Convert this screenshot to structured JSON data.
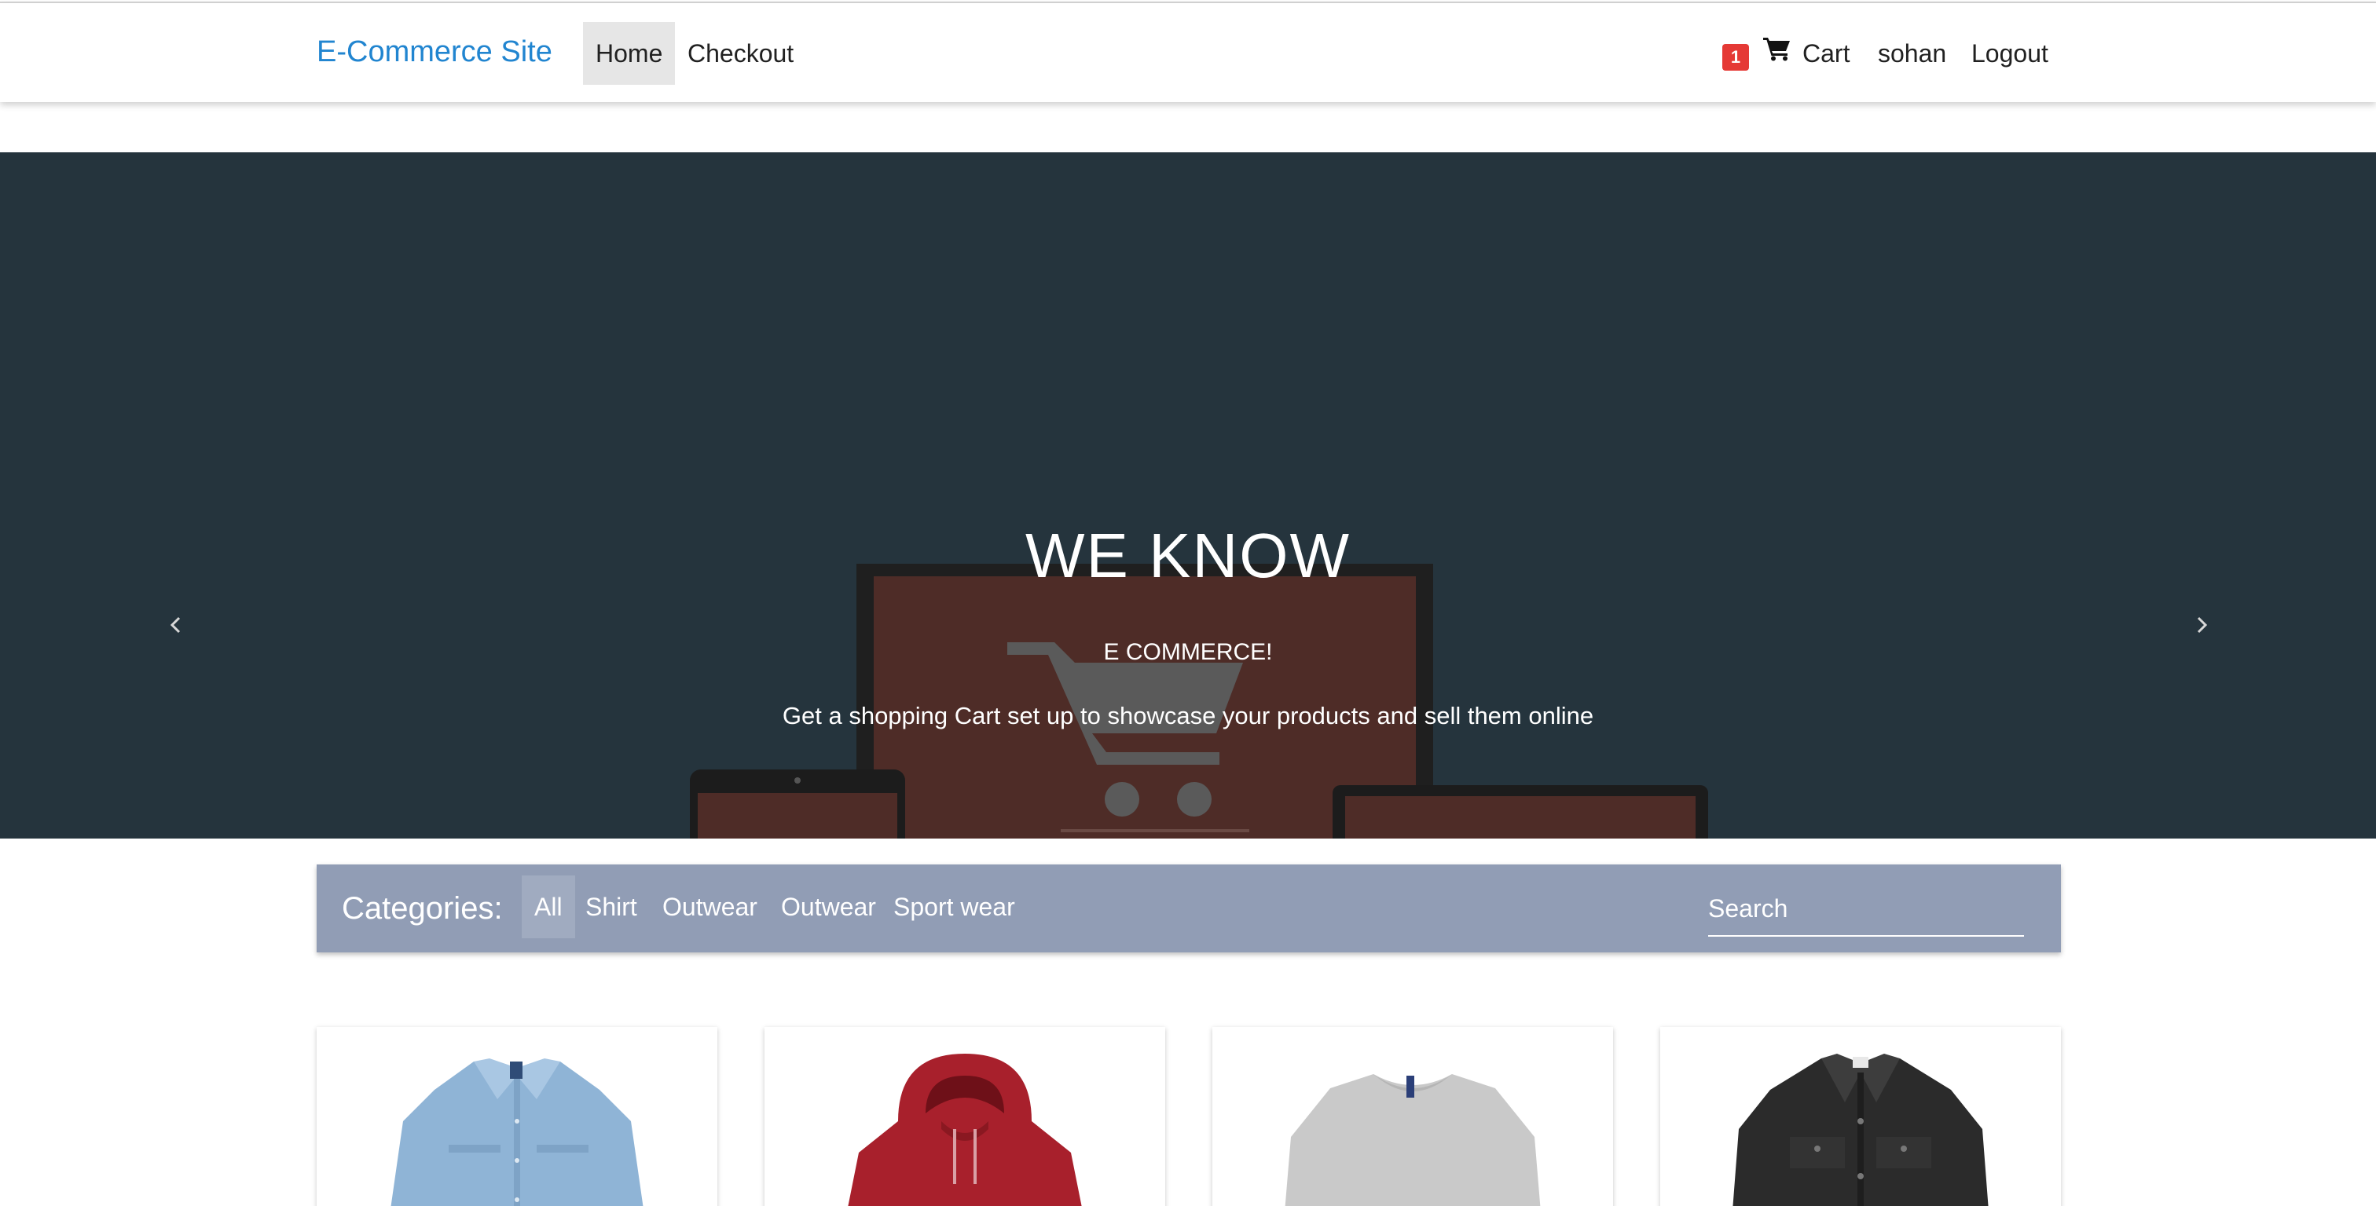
{
  "nav": {
    "brand": "E-Commerce Site",
    "home": "Home",
    "checkout": "Checkout",
    "cart_count": "1",
    "cart": "Cart",
    "user": "sohan",
    "logout": "Logout",
    "brand_color": "#2185d0",
    "badge_color": "#e53935"
  },
  "hero": {
    "title": "WE KNOW",
    "subtitle": "E COMMERCE!",
    "description": "Get a shopping Cart set up to showcase your products and sell them online",
    "background": "#25343d",
    "slide_count": 3,
    "active_slide": 1
  },
  "categories": {
    "label": "Categories:",
    "items": [
      "All",
      "Shirt",
      "Outwear",
      "Outwear",
      "Sport wear"
    ],
    "active": "All",
    "search_placeholder": "Search",
    "bar_color": "#919db5"
  },
  "products": [
    {
      "image": "denim-shirt"
    },
    {
      "image": "red-hoodie"
    },
    {
      "image": "grey-sweater"
    },
    {
      "image": "black-denim-jacket"
    }
  ]
}
